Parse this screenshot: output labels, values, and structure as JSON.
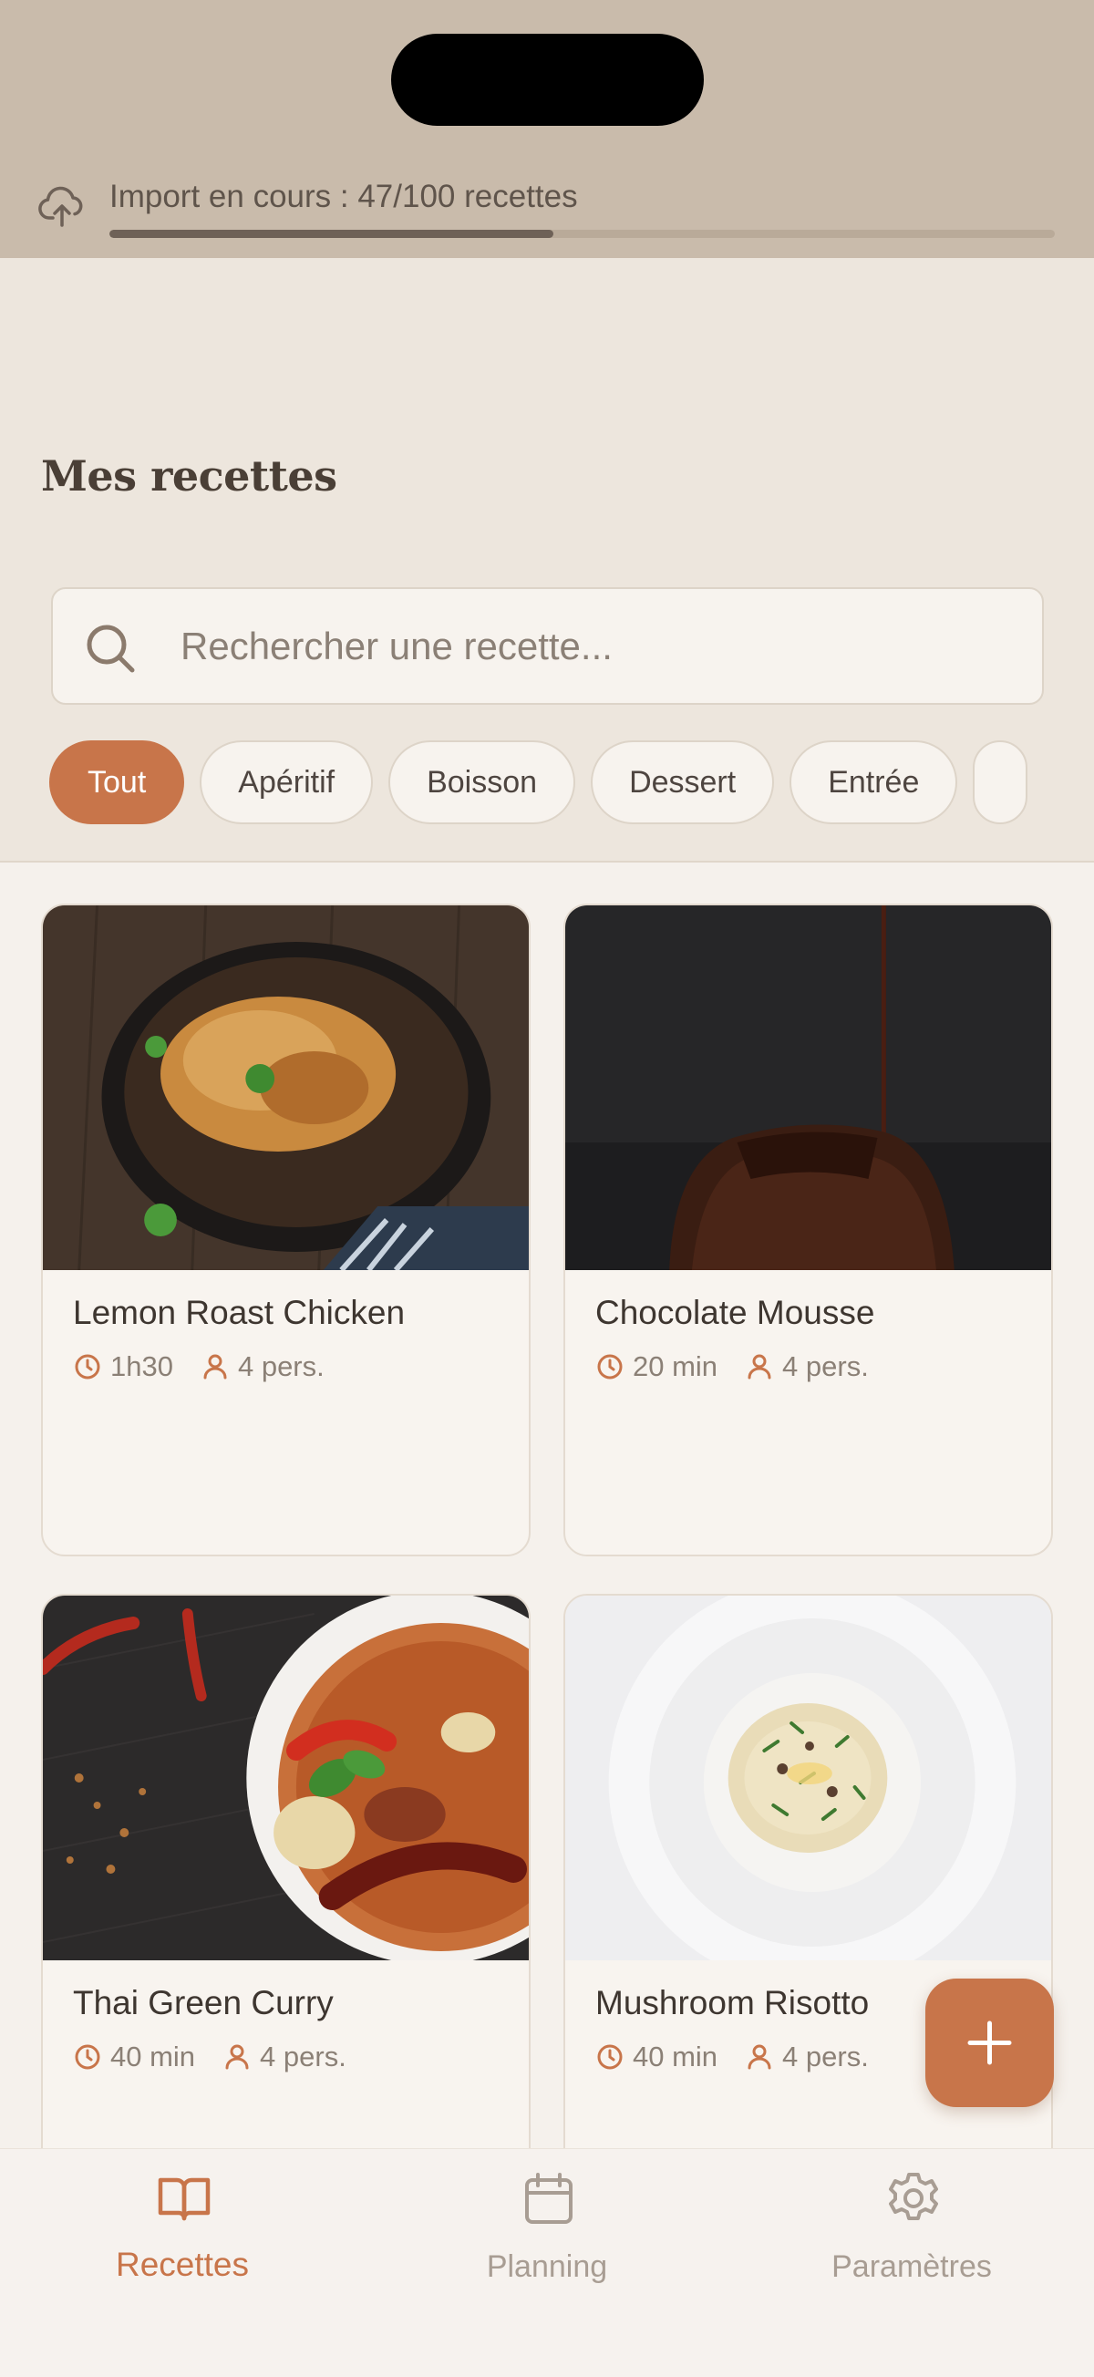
{
  "import": {
    "text": "Import en cours : 47/100 recettes",
    "progress": 0.47
  },
  "header": {
    "title": "Mes recettes"
  },
  "search": {
    "placeholder": "Rechercher une recette..."
  },
  "filters": [
    "Tout",
    "Apéritif",
    "Boisson",
    "Dessert",
    "Entrée",
    ""
  ],
  "recipes": [
    {
      "title": "Lemon Roast Chicken",
      "time": "1h30",
      "servings": "4 pers."
    },
    {
      "title": "Chocolate Mousse",
      "time": "20 min",
      "servings": "4 pers."
    },
    {
      "title": "Thai Green Curry",
      "time": "40 min",
      "servings": "4 pers."
    },
    {
      "title": "Mushroom Risotto",
      "time": "40 min",
      "servings": "4 pers."
    }
  ],
  "nav": {
    "recipes": "Recettes",
    "planning": "Planning",
    "settings": "Paramètres"
  },
  "colors": {
    "accent": "#c8754a",
    "banner": "#c9bbab",
    "background": "#ede6dd"
  }
}
